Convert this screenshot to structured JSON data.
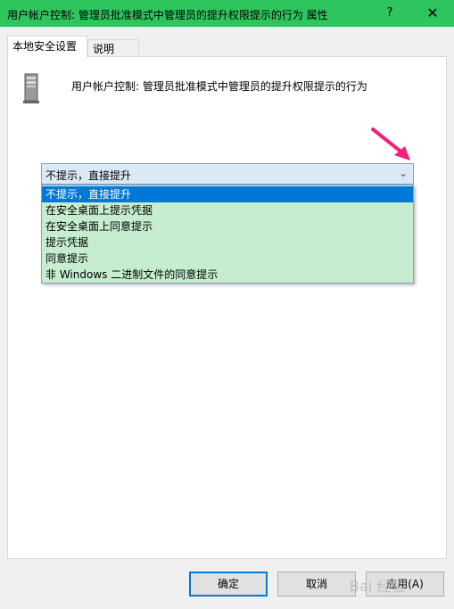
{
  "window": {
    "title": "用户帐户控制: 管理员批准模式中管理员的提升权限提示的行为 属性",
    "help_label": "?",
    "close_label": "✕"
  },
  "tabs": [
    {
      "label": "本地安全设置",
      "active": true
    },
    {
      "label": "说明",
      "active": false
    }
  ],
  "policy": {
    "title": "用户帐户控制: 管理员批准模式中管理员的提升权限提示的行为",
    "icon": "server-icon"
  },
  "dropdown": {
    "selected": "不提示，直接提升",
    "options": [
      "不提示，直接提升",
      "在安全桌面上提示凭据",
      "在安全桌面上同意提示",
      "提示凭据",
      "同意提示",
      "非 Windows 二进制文件的同意提示"
    ],
    "chevron": "⌄"
  },
  "buttons": {
    "ok": "确定",
    "cancel": "取消",
    "apply": "应用(A)"
  },
  "watermark": "Bai 经验",
  "colors": {
    "titlebar": "#2ec55f",
    "selected_option": "#0078d7",
    "list_bg": "#c6edcf",
    "arrow": "#ee2277"
  }
}
